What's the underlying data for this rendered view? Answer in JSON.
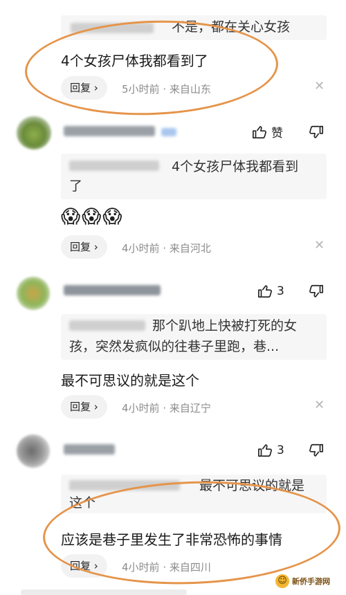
{
  "comments": [
    {
      "quote_text": "不是，都在关心女孩",
      "body": "4个女孩尸体我都看到了",
      "reply_label": "回复",
      "time": "5小时前",
      "location": "来自山东"
    },
    {
      "like_label": "赞",
      "quote_text_line1": "4个女孩尸体我都看到",
      "quote_text_line2": "了",
      "emoji": "😱😱😱",
      "reply_label": "回复",
      "time": "4小时前",
      "location": "来自河北"
    },
    {
      "like_count": "3",
      "quote_text_line1": "那个趴地上快被打死的女",
      "quote_text_line2": "孩，突然发疯似的往巷子里跑，巷...",
      "body": "最不可思议的就是这个",
      "reply_label": "回复",
      "time": "4小时前",
      "location": "来自辽宁"
    },
    {
      "like_count": "3",
      "quote_text_line1": "最不可思议的就是",
      "quote_text_line2": "这个",
      "body": "应该是巷子里发生了非常恐怖的事情",
      "reply_label": "回复",
      "time": "4小时前",
      "location": "来自四川"
    }
  ],
  "watermark": "新侨手游网",
  "colors": {
    "annotation": "#e5944a",
    "meta": "#8b8b8b",
    "quote_bg": "#f6f6f6"
  }
}
